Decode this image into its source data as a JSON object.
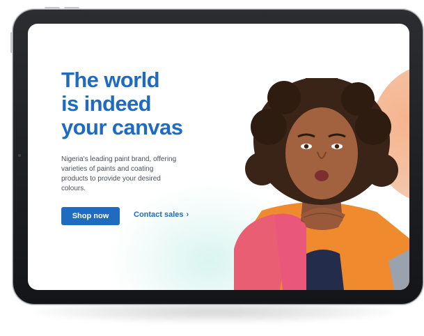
{
  "hero": {
    "title_lines": [
      "The world",
      "is indeed",
      "your canvas"
    ],
    "description": "Nigeria's leading paint brand, offering varieties of paints and coating products to provide your desired colours.",
    "primary_button": "Shop now",
    "secondary_link": "Contact sales",
    "secondary_link_icon": "chevron-right-icon"
  },
  "colors": {
    "brand_blue": "#1e6bc0",
    "accent_orange": "#f5b28c",
    "accent_teal": "#cdeee6",
    "device_frame": "#1f2024"
  }
}
